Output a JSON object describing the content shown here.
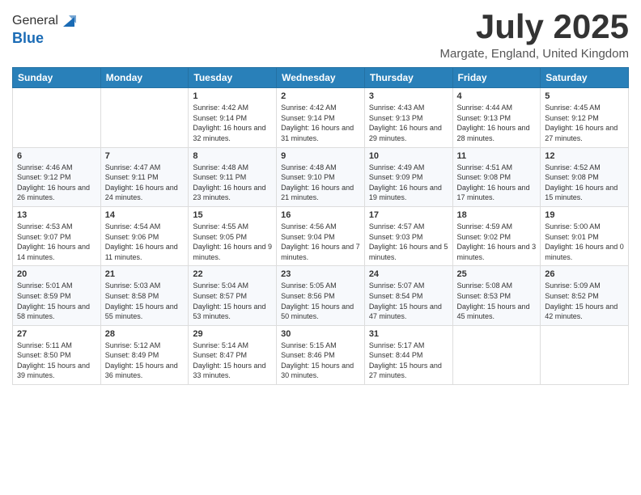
{
  "logo": {
    "general": "General",
    "blue": "Blue"
  },
  "title": "July 2025",
  "location": "Margate, England, United Kingdom",
  "days_of_week": [
    "Sunday",
    "Monday",
    "Tuesday",
    "Wednesday",
    "Thursday",
    "Friday",
    "Saturday"
  ],
  "weeks": [
    [
      {
        "day": null
      },
      {
        "day": null
      },
      {
        "day": "1",
        "sunrise": "Sunrise: 4:42 AM",
        "sunset": "Sunset: 9:14 PM",
        "daylight": "Daylight: 16 hours and 32 minutes."
      },
      {
        "day": "2",
        "sunrise": "Sunrise: 4:42 AM",
        "sunset": "Sunset: 9:14 PM",
        "daylight": "Daylight: 16 hours and 31 minutes."
      },
      {
        "day": "3",
        "sunrise": "Sunrise: 4:43 AM",
        "sunset": "Sunset: 9:13 PM",
        "daylight": "Daylight: 16 hours and 29 minutes."
      },
      {
        "day": "4",
        "sunrise": "Sunrise: 4:44 AM",
        "sunset": "Sunset: 9:13 PM",
        "daylight": "Daylight: 16 hours and 28 minutes."
      },
      {
        "day": "5",
        "sunrise": "Sunrise: 4:45 AM",
        "sunset": "Sunset: 9:12 PM",
        "daylight": "Daylight: 16 hours and 27 minutes."
      }
    ],
    [
      {
        "day": "6",
        "sunrise": "Sunrise: 4:46 AM",
        "sunset": "Sunset: 9:12 PM",
        "daylight": "Daylight: 16 hours and 26 minutes."
      },
      {
        "day": "7",
        "sunrise": "Sunrise: 4:47 AM",
        "sunset": "Sunset: 9:11 PM",
        "daylight": "Daylight: 16 hours and 24 minutes."
      },
      {
        "day": "8",
        "sunrise": "Sunrise: 4:48 AM",
        "sunset": "Sunset: 9:11 PM",
        "daylight": "Daylight: 16 hours and 23 minutes."
      },
      {
        "day": "9",
        "sunrise": "Sunrise: 4:48 AM",
        "sunset": "Sunset: 9:10 PM",
        "daylight": "Daylight: 16 hours and 21 minutes."
      },
      {
        "day": "10",
        "sunrise": "Sunrise: 4:49 AM",
        "sunset": "Sunset: 9:09 PM",
        "daylight": "Daylight: 16 hours and 19 minutes."
      },
      {
        "day": "11",
        "sunrise": "Sunrise: 4:51 AM",
        "sunset": "Sunset: 9:08 PM",
        "daylight": "Daylight: 16 hours and 17 minutes."
      },
      {
        "day": "12",
        "sunrise": "Sunrise: 4:52 AM",
        "sunset": "Sunset: 9:08 PM",
        "daylight": "Daylight: 16 hours and 15 minutes."
      }
    ],
    [
      {
        "day": "13",
        "sunrise": "Sunrise: 4:53 AM",
        "sunset": "Sunset: 9:07 PM",
        "daylight": "Daylight: 16 hours and 14 minutes."
      },
      {
        "day": "14",
        "sunrise": "Sunrise: 4:54 AM",
        "sunset": "Sunset: 9:06 PM",
        "daylight": "Daylight: 16 hours and 11 minutes."
      },
      {
        "day": "15",
        "sunrise": "Sunrise: 4:55 AM",
        "sunset": "Sunset: 9:05 PM",
        "daylight": "Daylight: 16 hours and 9 minutes."
      },
      {
        "day": "16",
        "sunrise": "Sunrise: 4:56 AM",
        "sunset": "Sunset: 9:04 PM",
        "daylight": "Daylight: 16 hours and 7 minutes."
      },
      {
        "day": "17",
        "sunrise": "Sunrise: 4:57 AM",
        "sunset": "Sunset: 9:03 PM",
        "daylight": "Daylight: 16 hours and 5 minutes."
      },
      {
        "day": "18",
        "sunrise": "Sunrise: 4:59 AM",
        "sunset": "Sunset: 9:02 PM",
        "daylight": "Daylight: 16 hours and 3 minutes."
      },
      {
        "day": "19",
        "sunrise": "Sunrise: 5:00 AM",
        "sunset": "Sunset: 9:01 PM",
        "daylight": "Daylight: 16 hours and 0 minutes."
      }
    ],
    [
      {
        "day": "20",
        "sunrise": "Sunrise: 5:01 AM",
        "sunset": "Sunset: 8:59 PM",
        "daylight": "Daylight: 15 hours and 58 minutes."
      },
      {
        "day": "21",
        "sunrise": "Sunrise: 5:03 AM",
        "sunset": "Sunset: 8:58 PM",
        "daylight": "Daylight: 15 hours and 55 minutes."
      },
      {
        "day": "22",
        "sunrise": "Sunrise: 5:04 AM",
        "sunset": "Sunset: 8:57 PM",
        "daylight": "Daylight: 15 hours and 53 minutes."
      },
      {
        "day": "23",
        "sunrise": "Sunrise: 5:05 AM",
        "sunset": "Sunset: 8:56 PM",
        "daylight": "Daylight: 15 hours and 50 minutes."
      },
      {
        "day": "24",
        "sunrise": "Sunrise: 5:07 AM",
        "sunset": "Sunset: 8:54 PM",
        "daylight": "Daylight: 15 hours and 47 minutes."
      },
      {
        "day": "25",
        "sunrise": "Sunrise: 5:08 AM",
        "sunset": "Sunset: 8:53 PM",
        "daylight": "Daylight: 15 hours and 45 minutes."
      },
      {
        "day": "26",
        "sunrise": "Sunrise: 5:09 AM",
        "sunset": "Sunset: 8:52 PM",
        "daylight": "Daylight: 15 hours and 42 minutes."
      }
    ],
    [
      {
        "day": "27",
        "sunrise": "Sunrise: 5:11 AM",
        "sunset": "Sunset: 8:50 PM",
        "daylight": "Daylight: 15 hours and 39 minutes."
      },
      {
        "day": "28",
        "sunrise": "Sunrise: 5:12 AM",
        "sunset": "Sunset: 8:49 PM",
        "daylight": "Daylight: 15 hours and 36 minutes."
      },
      {
        "day": "29",
        "sunrise": "Sunrise: 5:14 AM",
        "sunset": "Sunset: 8:47 PM",
        "daylight": "Daylight: 15 hours and 33 minutes."
      },
      {
        "day": "30",
        "sunrise": "Sunrise: 5:15 AM",
        "sunset": "Sunset: 8:46 PM",
        "daylight": "Daylight: 15 hours and 30 minutes."
      },
      {
        "day": "31",
        "sunrise": "Sunrise: 5:17 AM",
        "sunset": "Sunset: 8:44 PM",
        "daylight": "Daylight: 15 hours and 27 minutes."
      },
      {
        "day": null
      },
      {
        "day": null
      }
    ]
  ]
}
